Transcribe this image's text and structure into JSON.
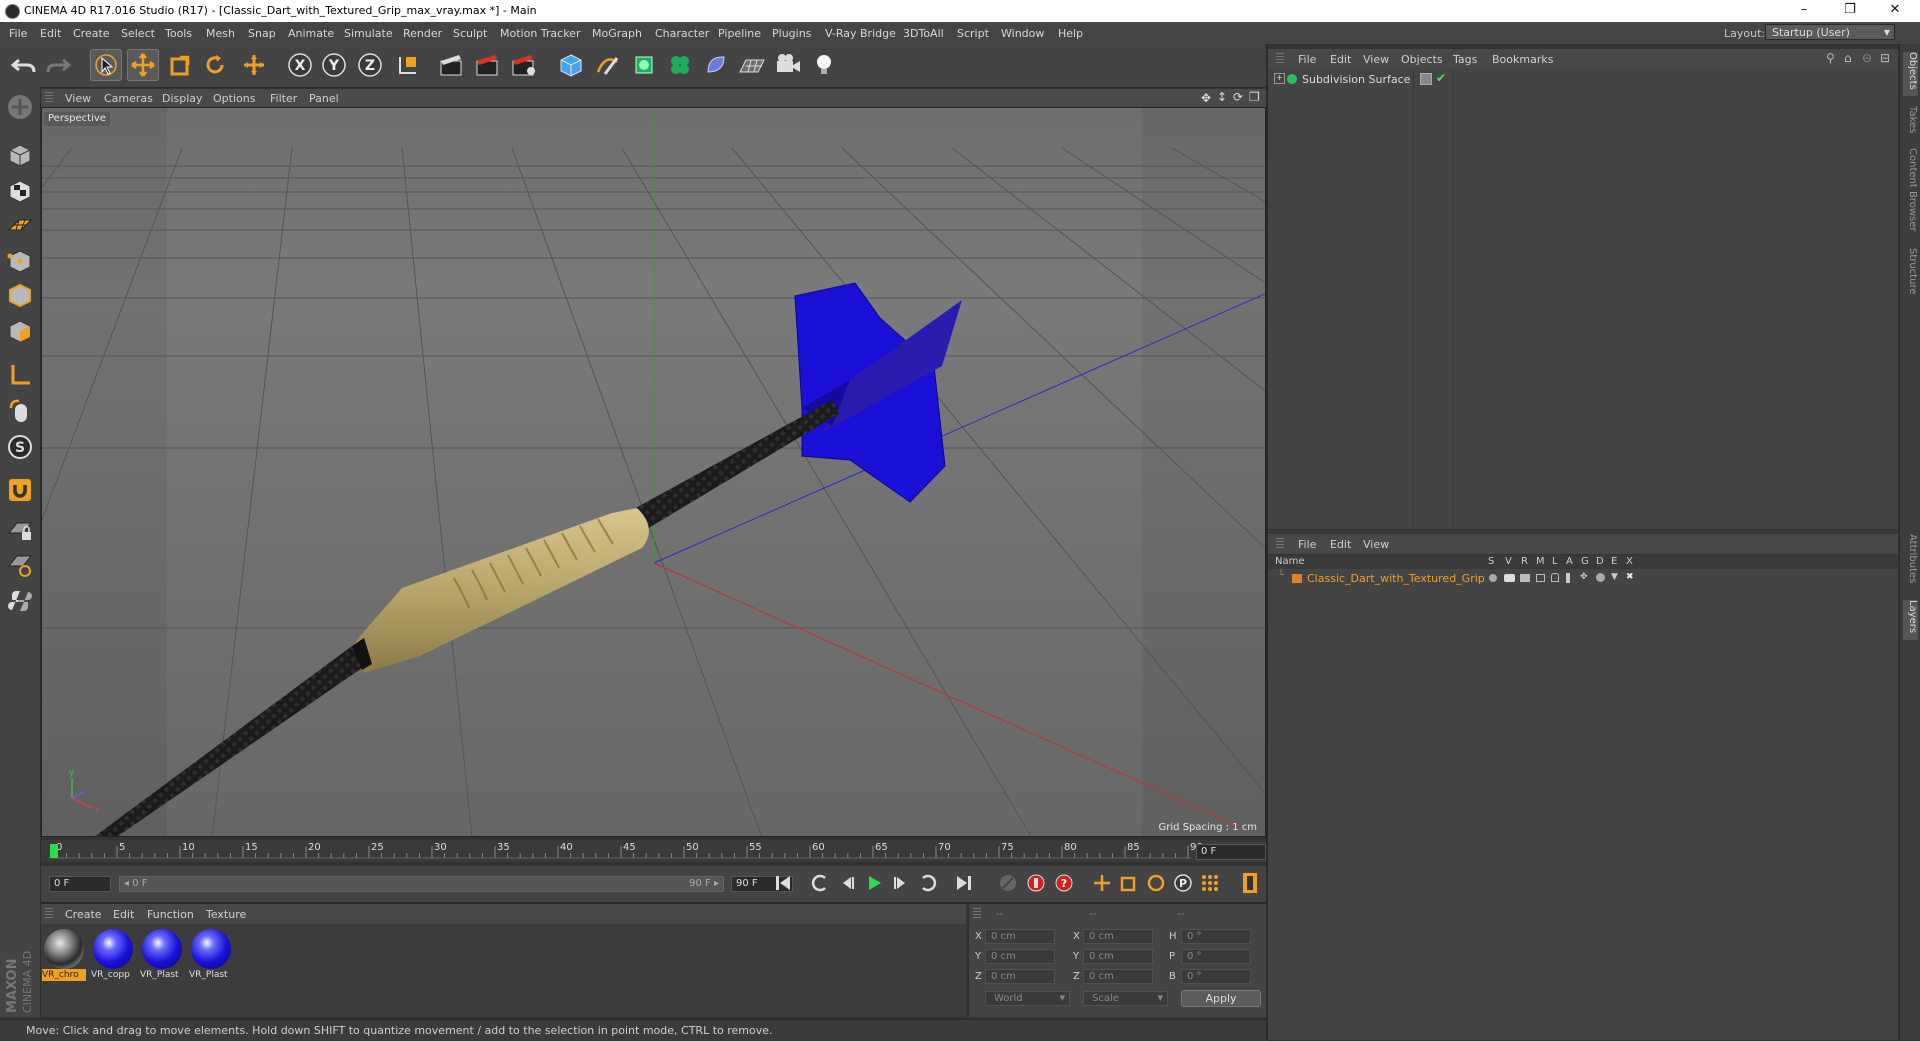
{
  "window": {
    "title": "CINEMA 4D R17.016 Studio (R17) - [Classic_Dart_with_Textured_Grip_max_vray.max *] - Main",
    "controls": [
      "–",
      "❐",
      "✕"
    ]
  },
  "menu": [
    "File",
    "Edit",
    "Create",
    "Select",
    "Tools",
    "Mesh",
    "Snap",
    "Animate",
    "Simulate",
    "Render",
    "Sculpt",
    "Motion Tracker",
    "MoGraph",
    "Character",
    "Pipeline",
    "Plugins",
    "V-Ray Bridge",
    "3DToAll",
    "Script",
    "Window",
    "Help"
  ],
  "layout": {
    "label": "Layout:",
    "value": "Startup (User)"
  },
  "viewport": {
    "menu": [
      "View",
      "Cameras",
      "Display",
      "Options",
      "Filter",
      "Panel"
    ],
    "label": "Perspective",
    "grid_spacing": "Grid Spacing : 1 cm"
  },
  "timeline": {
    "ticks": [
      "0",
      "5",
      "10",
      "15",
      "20",
      "25",
      "30",
      "35",
      "40",
      "45",
      "50",
      "55",
      "60",
      "65",
      "70",
      "75",
      "80",
      "85",
      "90"
    ],
    "current_frame": "0 F",
    "start_field": "0 F",
    "range_start": "◂ 0 F",
    "range_end": "90 F ▸",
    "end_field": "90 F"
  },
  "materials": {
    "menu": [
      "Create",
      "Edit",
      "Function",
      "Texture"
    ],
    "items": [
      {
        "label": "VR_chro",
        "selected": true
      },
      {
        "label": "VR_copp",
        "selected": false
      },
      {
        "label": "VR_Plast",
        "selected": false
      },
      {
        "label": "VR_Plast",
        "selected": false
      }
    ]
  },
  "coords": {
    "headers": [
      "--",
      "--",
      "--"
    ],
    "rows": [
      {
        "l1": "X",
        "v1": "0 cm",
        "l2": "X",
        "v2": "0 cm",
        "l3": "H",
        "v3": "0 °"
      },
      {
        "l1": "Y",
        "v1": "0 cm",
        "l2": "Y",
        "v2": "0 cm",
        "l3": "P",
        "v3": "0 °"
      },
      {
        "l1": "Z",
        "v1": "0 cm",
        "l2": "Z",
        "v2": "0 cm",
        "l3": "B",
        "v3": "0 °"
      }
    ],
    "world": "World",
    "scale": "Scale",
    "apply": "Apply"
  },
  "status": "Move: Click and drag to move elements. Hold down SHIFT to quantize movement / add to the selection in point mode, CTRL to remove.",
  "objects": {
    "menu": [
      "File",
      "Edit",
      "View",
      "Objects",
      "Tags",
      "Bookmarks"
    ],
    "item": "Subdivision Surface"
  },
  "layers": {
    "menu": [
      "File",
      "Edit",
      "View"
    ],
    "columns": [
      "Name",
      "S",
      "V",
      "R",
      "M",
      "L",
      "A",
      "G",
      "D",
      "E",
      "X"
    ],
    "item": "Classic_Dart_with_Textured_Grip"
  },
  "right_tabs": [
    "Objects",
    "Takes",
    "Content Browser",
    "Structure",
    "Attributes",
    "Layers"
  ],
  "brand": {
    "line1": "MAXON",
    "line2": "CINEMA 4D"
  },
  "colors": {
    "accent_orange": "#f0a020",
    "layer_orange": "#e08020",
    "dart_blue": "#1a10d8",
    "grip_gold": "#b7a56a"
  }
}
